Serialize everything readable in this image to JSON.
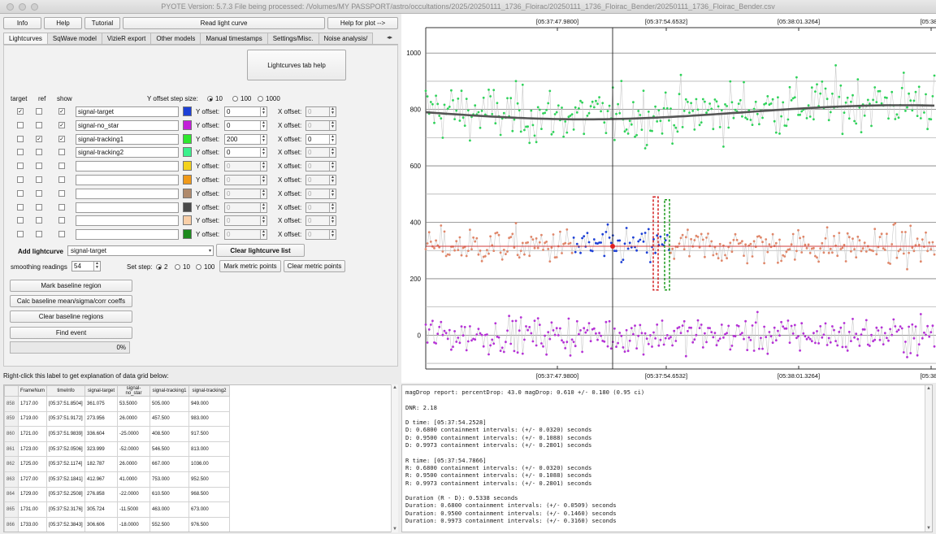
{
  "window": {
    "title": "PYOTE Version: 5.7.3  File being processed: /Volumes/MY PASSPORT/astro/occultations/2025/20250111_1736_Floirac/20250111_1736_Floirac_Bender/20250111_1736_Floirac_Bender.csv"
  },
  "topbar": {
    "info": "Info",
    "help": "Help",
    "tutorial": "Tutorial",
    "read": "Read light curve",
    "plot_help": "Help for plot -->"
  },
  "tabs": [
    "Lightcurves",
    "SqWave model",
    "VizieR export",
    "Other models",
    "Manual timestamps",
    "Settings/Misc.",
    "Noise analysis/"
  ],
  "lc": {
    "tab_help": "Lightcurves tab help",
    "hdr_target": "target",
    "hdr_ref": "ref",
    "hdr_show": "show",
    "step_label": "Y offset step size:",
    "step_options": [
      "10",
      "100",
      "1000"
    ],
    "yoff_label": "Y offset:",
    "xoff_label": "X offset:",
    "rows": [
      {
        "target": true,
        "ref": false,
        "show": true,
        "name": "signal-target",
        "color": "#1c3fd6",
        "yoff": "0",
        "xoff": "0",
        "enabled": true,
        "xenabled": false
      },
      {
        "target": false,
        "ref": false,
        "show": true,
        "name": "signal-no_star",
        "color": "#c21ed8",
        "yoff": "0",
        "xoff": "0",
        "enabled": true,
        "xenabled": false
      },
      {
        "target": false,
        "ref": true,
        "show": true,
        "name": "signal-tracking1",
        "color": "#2ee82e",
        "yoff": "200",
        "xoff": "0",
        "enabled": true,
        "xenabled": true
      },
      {
        "target": false,
        "ref": false,
        "show": false,
        "name": "signal-tracking2",
        "color": "#3bf08c",
        "yoff": "0",
        "xoff": "0",
        "enabled": true,
        "xenabled": false
      },
      {
        "target": false,
        "ref": false,
        "show": false,
        "name": "",
        "color": "#f3d21c",
        "yoff": "0",
        "xoff": "0",
        "enabled": false,
        "xenabled": false
      },
      {
        "target": false,
        "ref": false,
        "show": false,
        "name": "",
        "color": "#f09a1a",
        "yoff": "0",
        "xoff": "0",
        "enabled": false,
        "xenabled": false
      },
      {
        "target": false,
        "ref": false,
        "show": false,
        "name": "",
        "color": "#b08a6c",
        "yoff": "0",
        "xoff": "0",
        "enabled": false,
        "xenabled": false
      },
      {
        "target": false,
        "ref": false,
        "show": false,
        "name": "",
        "color": "#4a4a4a",
        "yoff": "0",
        "xoff": "0",
        "enabled": false,
        "xenabled": false
      },
      {
        "target": false,
        "ref": false,
        "show": false,
        "name": "",
        "color": "#f9cfa8",
        "yoff": "0",
        "xoff": "0",
        "enabled": false,
        "xenabled": false
      },
      {
        "target": false,
        "ref": false,
        "show": false,
        "name": "",
        "color": "#1d8a1d",
        "yoff": "0",
        "xoff": "0",
        "enabled": false,
        "xenabled": false
      }
    ],
    "add_lc": "Add lightcurve",
    "add_lc_value": "signal-target",
    "clear_list": "Clear lightcurve list",
    "smoothing_label": "smoothing readings",
    "smoothing_value": "54",
    "set_step": "Set step:",
    "set_step_options": [
      "2",
      "10",
      "100"
    ],
    "mark_metric": "Mark metric points",
    "clear_metric": "Clear metric points",
    "mark_baseline": "Mark baseline region",
    "calc_baseline": "Calc baseline mean/sigma/corr coeffs",
    "clear_baseline": "Clear baseline regions",
    "find_event": "Find event",
    "progress": "0%"
  },
  "grid": {
    "label": "Right-click this label to get explanation of data grid below:",
    "columns": [
      "FrameNum",
      "timeInfo",
      "signal-target",
      "signal-no_star",
      "signal-tracking1",
      "signal-tracking2"
    ],
    "rows": [
      [
        "858",
        "1717.00",
        "[05:37:51.8504]",
        "361.075",
        "53.5000",
        "505.000",
        "949.000"
      ],
      [
        "859",
        "1719.00",
        "[05:37:51.9172]",
        "273.956",
        "26.0000",
        "457.500",
        "983.000"
      ],
      [
        "860",
        "1721.00",
        "[05:37:51.9839]",
        "336.604",
        "-25.0000",
        "408.500",
        "917.500"
      ],
      [
        "861",
        "1723.00",
        "[05:37:52.0506]",
        "323.999",
        "-52.0000",
        "546.500",
        "813.000"
      ],
      [
        "862",
        "1725.00",
        "[05:37:52.1174]",
        "182.787",
        "26.0000",
        "667.000",
        "1036.00"
      ],
      [
        "863",
        "1727.00",
        "[05:37:52.1841]",
        "412.967",
        "41.0000",
        "753.000",
        "952.500"
      ],
      [
        "864",
        "1729.00",
        "[05:37:52.2508]",
        "276.858",
        "-22.0000",
        "610.500",
        "968.500"
      ],
      [
        "865",
        "1731.00",
        "[05:37:52.3176]",
        "305.724",
        "-11.5000",
        "463.000",
        "673.000"
      ],
      [
        "866",
        "1733.00",
        "[05:37:52.3843]",
        "306.606",
        "-18.0000",
        "552.500",
        "976.500"
      ]
    ]
  },
  "report": {
    "lines": [
      "magDrop report: percentDrop: 43.0 magDrop: 0.610 +/- 0.180 (0.95 ci)",
      "",
      "DNR: 2.18",
      "",
      "D time: [05:37:54.2528]",
      "D: 0.6800 containment intervals: (+/- 0.0320) seconds",
      "D: 0.9500 containment intervals: (+/- 0.1088) seconds",
      "D: 0.9973 containment intervals: (+/- 0.2801) seconds",
      "",
      "R time: [05:37:54.7866]",
      "R: 0.6800 containment intervals: (+/- 0.0320) seconds",
      "R: 0.9500 containment intervals: (+/- 0.1088) seconds",
      "R: 0.9973 containment intervals: (+/- 0.2801) seconds",
      "",
      "Duration (R - D): 0.5338 seconds",
      "Duration: 0.6800 containment intervals: (+/- 0.0509) seconds",
      "Duration: 0.9500 containment intervals: (+/- 0.1460) seconds",
      "Duration: 0.9973 containment intervals: (+/- 0.3160) seconds"
    ]
  },
  "chart_data": {
    "type": "scatter",
    "top_ticks": [
      "[05:37:47.9800]",
      "[05:37:54.6532]",
      "[05:38:01.3264]",
      "[05:38:0"
    ],
    "bottom_ticks": [
      "[05:37:47.9800]",
      "[05:37:54.6532]",
      "[05:38:01.3264]",
      "[05:38:0"
    ],
    "y_ticks": [
      0,
      200,
      400,
      600,
      800,
      1000
    ],
    "ylim": [
      -120,
      1090
    ],
    "grid": true,
    "colors": {
      "tracking": "#2fd35a",
      "tracking_fit": "#555555",
      "target": "#e0876a",
      "target_event": "#1c3fd6",
      "no_star": "#b531d6",
      "baseline": "#d23a3a",
      "d_edge": "#d21e1e",
      "r_edge": "#1a9a1a",
      "cursor": "#222222"
    },
    "series": [
      {
        "name": "signal-tracking1",
        "mean": 800,
        "sd": 70
      },
      {
        "name": "signal-target",
        "mean": 315,
        "sd": 45,
        "event_mean": 250
      },
      {
        "name": "signal-no_star",
        "mean": 0,
        "sd": 45
      }
    ]
  }
}
